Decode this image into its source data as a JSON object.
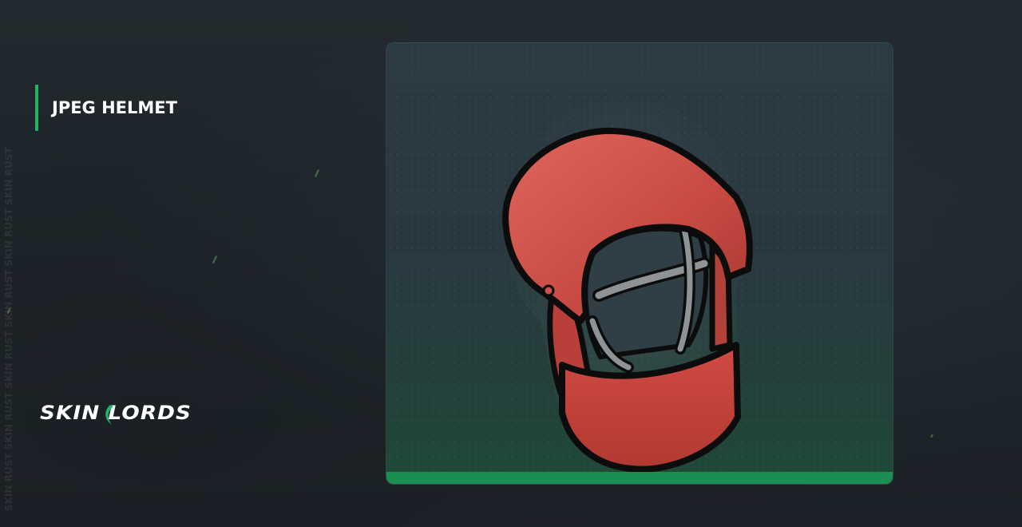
{
  "item": {
    "name": "JPEG HELMET",
    "image_icon": "jpeg-helmet-image"
  },
  "brand": {
    "logo_text": "SKIN LORDS",
    "side_watermark": "SKIN RUST SKIN RUST SKIN RUST SKIN RUST SKIN RUST SKIN RUST"
  },
  "colors": {
    "accent": "#1fb561",
    "card_bottom": "#1b8f52",
    "background": "#1f262b",
    "helmet_red": "#d9544a"
  }
}
